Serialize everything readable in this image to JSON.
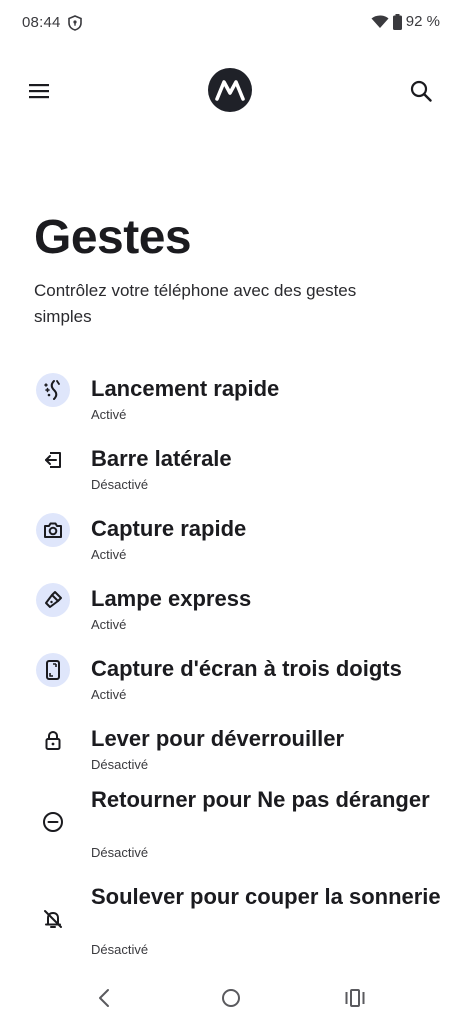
{
  "status": {
    "time": "08:44",
    "battery": "92 %"
  },
  "app_bar": {
    "menu_icon": "hamburger-menu-icon",
    "logo_icon": "motorola-logo",
    "search_icon": "search-icon"
  },
  "page": {
    "title": "Gestes",
    "subtitle": "Contrôlez votre téléphone avec des gestes simples"
  },
  "gestures": [
    {
      "title": "Lancement rapide",
      "status": "Activé",
      "icon": "quick-launch-icon",
      "active": true
    },
    {
      "title": "Barre latérale",
      "status": "Désactivé",
      "icon": "sidebar-icon",
      "active": false
    },
    {
      "title": "Capture rapide",
      "status": "Activé",
      "icon": "camera-icon",
      "active": true
    },
    {
      "title": "Lampe express",
      "status": "Activé",
      "icon": "flashlight-icon",
      "active": true
    },
    {
      "title": "Capture d'écran à trois doigts",
      "status": "Activé",
      "icon": "three-finger-screenshot-icon",
      "active": true
    },
    {
      "title": "Lever pour déverrouiller",
      "status": "Désactivé",
      "icon": "lock-icon",
      "active": false
    },
    {
      "title": "Retourner pour Ne pas déranger",
      "status": "Désactivé",
      "icon": "do-not-disturb-icon",
      "active": false
    },
    {
      "title": "Soulever pour couper la sonnerie",
      "status": "Désactivé",
      "icon": "bell-off-icon",
      "active": false
    }
  ],
  "colors": {
    "active_icon_bg": "#dfe6fb",
    "text_primary": "#1b1b1f"
  }
}
